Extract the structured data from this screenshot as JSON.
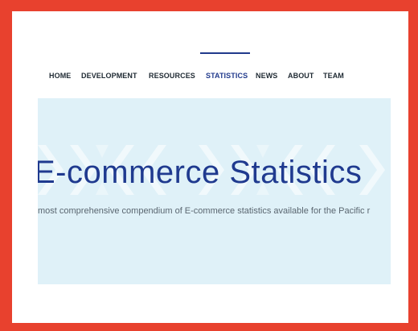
{
  "nav": {
    "items": [
      {
        "label": "HOME"
      },
      {
        "label": "DEVELOPMENT"
      },
      {
        "label": "RESOURCES"
      },
      {
        "label": "STATISTICS",
        "active": true
      },
      {
        "label": "NEWS"
      },
      {
        "label": "ABOUT"
      },
      {
        "label": "TEAM"
      }
    ]
  },
  "hero": {
    "title": "E-commerce Statistics",
    "subtitle": "most comprehensive compendium of E-commerce statistics available for the Pacific r"
  },
  "colors": {
    "frame": "#e8412e",
    "accent": "#213a8c",
    "hero_background": "#dff1f8",
    "nav_text": "#1f2a33"
  }
}
